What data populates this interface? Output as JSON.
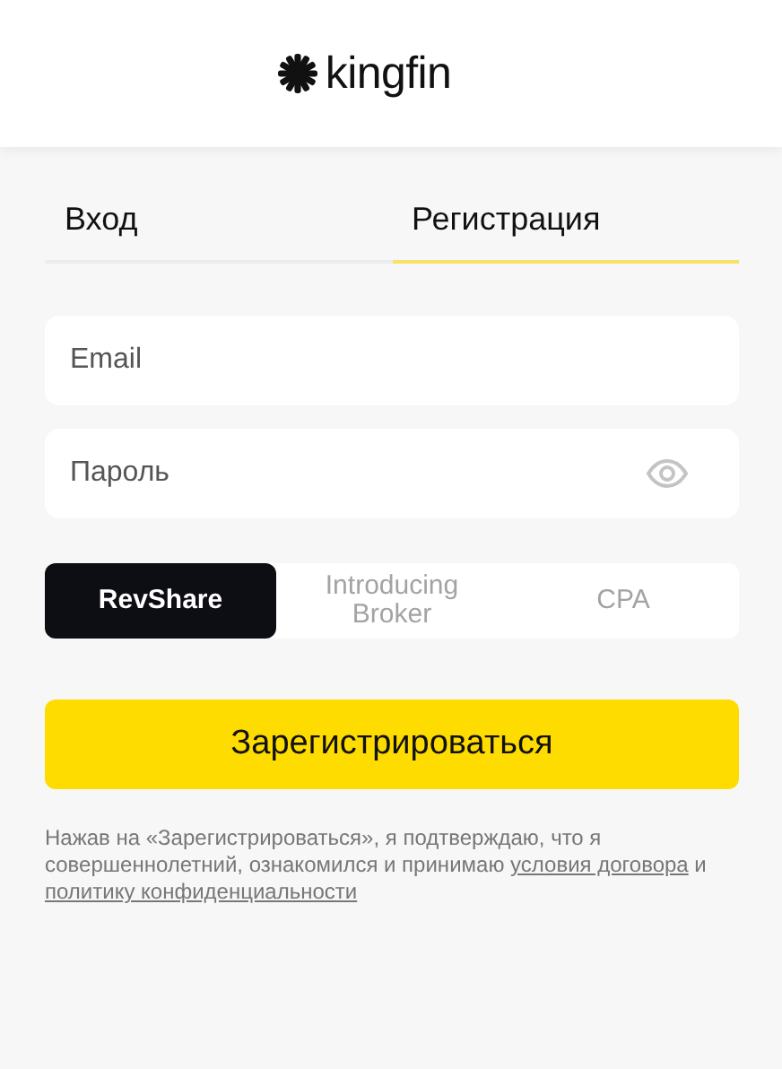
{
  "header": {
    "logo_text": "kingfin"
  },
  "tabs": [
    {
      "label": "Вход",
      "selected": false
    },
    {
      "label": "Регистрация",
      "selected": true
    }
  ],
  "fields": [
    {
      "kind": "text",
      "placeholder": "Email"
    },
    {
      "kind": "password",
      "placeholder": "Пароль"
    }
  ],
  "plans": [
    {
      "label": "RevShare",
      "selected": true
    },
    {
      "label": "Introducing Broker",
      "selected": false
    },
    {
      "label": "CPA",
      "selected": false
    }
  ],
  "submit_button": "Зарегистрироваться",
  "legal": {
    "text": "Нажав на «Зарегистрироваться», я подтверждаю, что я совершеннолетний, ознакомился и принимаю",
    "terms_link": "условия договора",
    "conjunction": "и",
    "privacy_link": "политику конфиденциальности"
  }
}
